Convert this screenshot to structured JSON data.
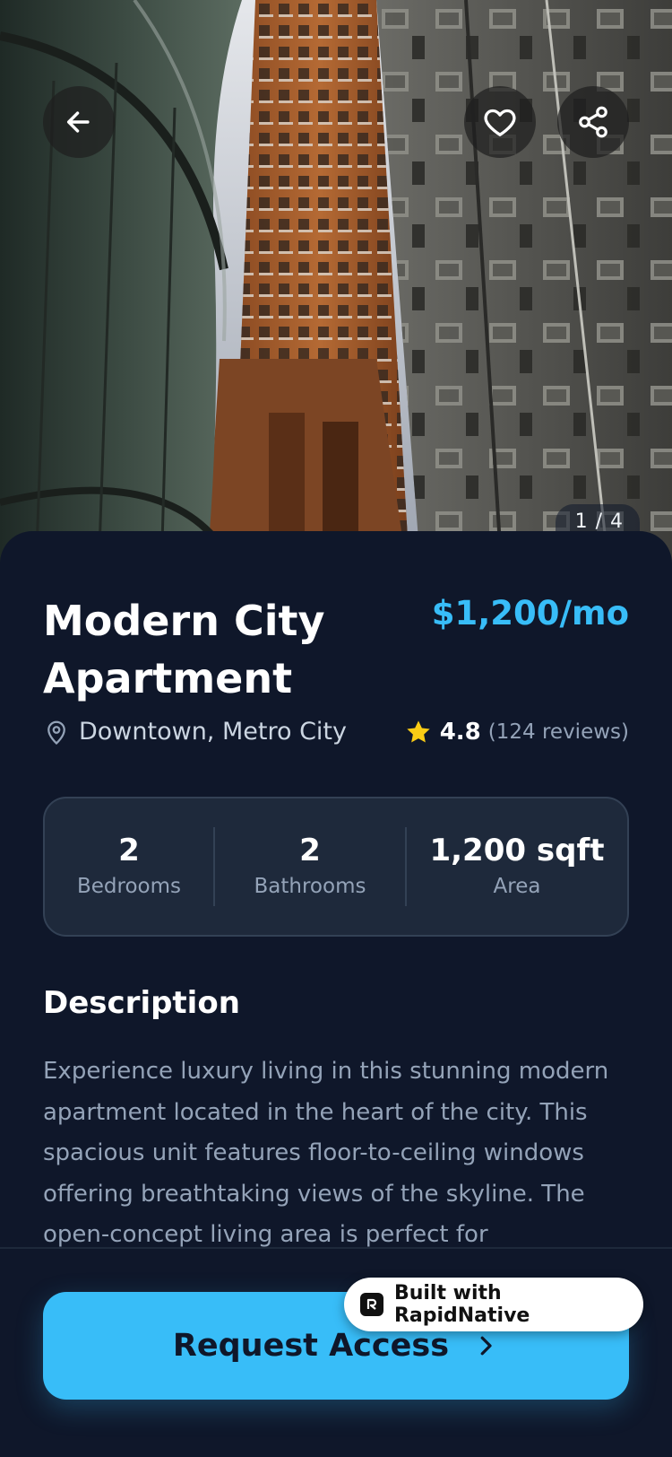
{
  "colors": {
    "background": "#0f172a",
    "card": "#1e293b",
    "accent": "#38bdf8",
    "star": "#facc15",
    "muted_text": "#94a3b8"
  },
  "header": {
    "back_icon": "arrow-left-icon",
    "favorite_icon": "heart-icon",
    "share_icon": "share-icon",
    "image_counter": "1 / 4"
  },
  "listing": {
    "title": "Modern City Apartment",
    "price": "$1,200/mo",
    "location_icon": "map-pin-icon",
    "location": "Downtown, Metro City",
    "rating_icon": "star-icon",
    "rating": "4.8",
    "reviews": "(124 reviews)"
  },
  "stats": [
    {
      "value": "2",
      "label": "Bedrooms"
    },
    {
      "value": "2",
      "label": "Bathrooms"
    },
    {
      "value": "1,200 sqft",
      "label": "Area"
    }
  ],
  "description": {
    "heading": "Description",
    "text": "Experience luxury living in this stunning modern apartment located in the heart of the city. This spacious unit features floor-to-ceiling windows offering breathtaking views of the skyline. The open-concept living area is perfect for"
  },
  "cta": {
    "label": "Request Access",
    "icon": "chevron-right-icon"
  },
  "badge": {
    "label": "Built with RapidNative",
    "icon": "rapidnative-logo-icon"
  }
}
